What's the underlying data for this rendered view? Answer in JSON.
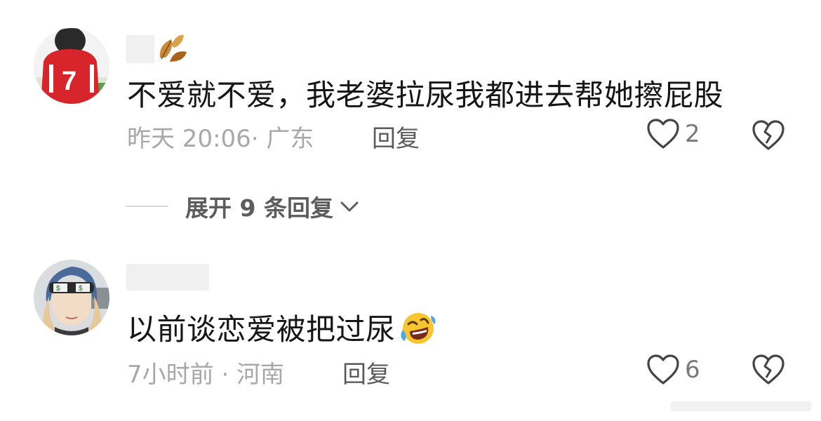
{
  "comments": [
    {
      "avatar_icon": "football-player-avatar",
      "name_icon": "autumn-leaves-icon",
      "text": "不爱就不爱，我老婆拉尿我都进去帮她擦屁股",
      "meta": "昨天 20:06· 广东",
      "reply_label": "回复",
      "like_count": "2"
    },
    {
      "avatar_icon": "goggles-person-avatar",
      "text": "以前谈恋爱被把过尿",
      "emoji": "rolling-laughing-emoji",
      "meta": "7小时前 · 河南",
      "reply_label": "回复",
      "like_count": "6"
    }
  ],
  "expand_replies": {
    "label": "展开 9 条回复"
  }
}
